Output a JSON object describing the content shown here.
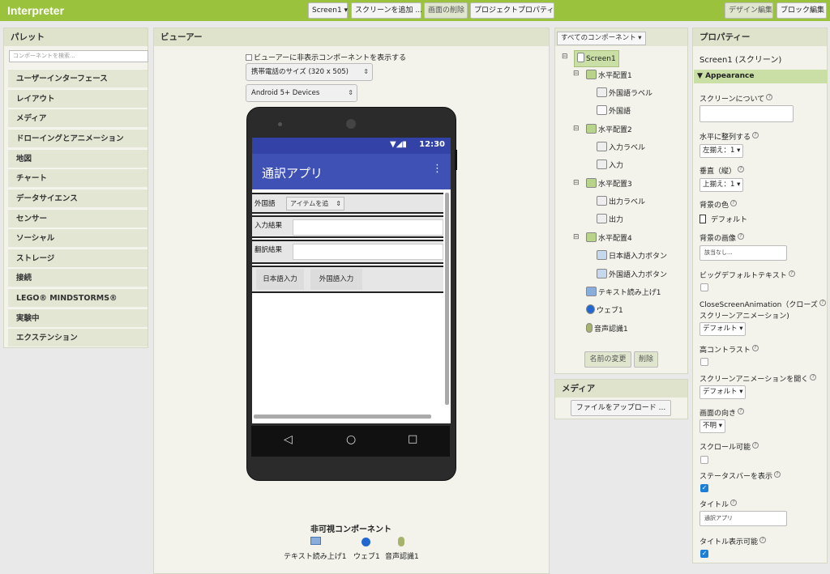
{
  "app": {
    "title": "Interpreter"
  },
  "toolbar": {
    "screen_select": "Screen1 ▾",
    "add_screen": "スクリーンを追加 ...",
    "delete_screen": "画面の削除",
    "project_props": "プロジェクトプロパティ",
    "design_edit": "デザイン編集",
    "block_edit": "ブロック編集"
  },
  "palette": {
    "title": "パレット",
    "search_placeholder": "コンポーネントを検索...",
    "categories": [
      "ユーザーインターフェース",
      "レイアウト",
      "メディア",
      "ドローイングとアニメーション",
      "地図",
      "チャート",
      "データサイエンス",
      "センサー",
      "ソーシャル",
      "ストレージ",
      "接続",
      "LEGO® MINDSTORMS®",
      "実験中",
      "エクステンション"
    ]
  },
  "viewer": {
    "title": "ビューアー",
    "show_hidden": "ビューアーに非表示コンポーネントを表示する",
    "device_size": "携帯電話のサイズ (320 x 505)",
    "android": "Android 5+ Devices",
    "time": "12:30",
    "app_title": "通訳アプリ",
    "row1_label": "外国語",
    "spinner": "アイテムを追",
    "row2_label": "入力結果",
    "row3_label": "翻訳結果",
    "btn_japanese": "日本語入力",
    "btn_foreign": "外国語入力",
    "nonvisible_title": "非可視コンポーネント",
    "nonvisible": [
      "テキスト読み上げ1",
      "ウェブ1",
      "音声認識1"
    ]
  },
  "components": {
    "dropdown": "すべてのコンポーネント ▾",
    "tree": {
      "screen": "Screen1",
      "h1": "水平配置1",
      "h1_label": "外国語ラベル",
      "h1_item": "外国語",
      "h2": "水平配置2",
      "h2_label": "入力ラベル",
      "h2_item": "入力",
      "h3": "水平配置3",
      "h3_label": "出力ラベル",
      "h3_item": "出力",
      "h4": "水平配置4",
      "h4_btn1": "日本語入力ボタン",
      "h4_btn2": "外国語入力ボタン",
      "tts": "テキスト読み上げ1",
      "web": "ウェブ1",
      "speech": "音声認識1"
    },
    "rename": "名前の変更",
    "delete": "削除"
  },
  "media": {
    "title": "メディア",
    "upload": "ファイルをアップロード ..."
  },
  "properties": {
    "title": "プロパティー",
    "subtitle": "Screen1 (スクリーン)",
    "section": "Appearance",
    "about": "スクリーンについて",
    "align_h": "水平に整列する",
    "align_h_val": "左揃え：1 ▾",
    "align_v": "垂直（縦）",
    "align_v_val": "上揃え：1 ▾",
    "bg_color": "背景の色",
    "bg_color_val": "デフォルト",
    "bg_image": "背景の画像",
    "bg_image_val": "該当なし...",
    "big_text": "ビッグデフォルトテキスト",
    "close_anim": "CloseScreenAnimation（クローズ",
    "close_anim2": "スクリーンアニメーション)",
    "close_anim_val": "デフォルト ▾",
    "high_contrast": "高コントラスト",
    "open_anim": "スクリーンアニメーションを開く",
    "open_anim_val": "デフォルト ▾",
    "orientation": "画面の向き",
    "orientation_val": "不明 ▾",
    "scrollable": "スクロール可能",
    "status_bar": "ステータスバーを表示",
    "title_label": "タイトル",
    "title_val": "通訳アプリ",
    "title_visible": "タイトル表示可能"
  }
}
